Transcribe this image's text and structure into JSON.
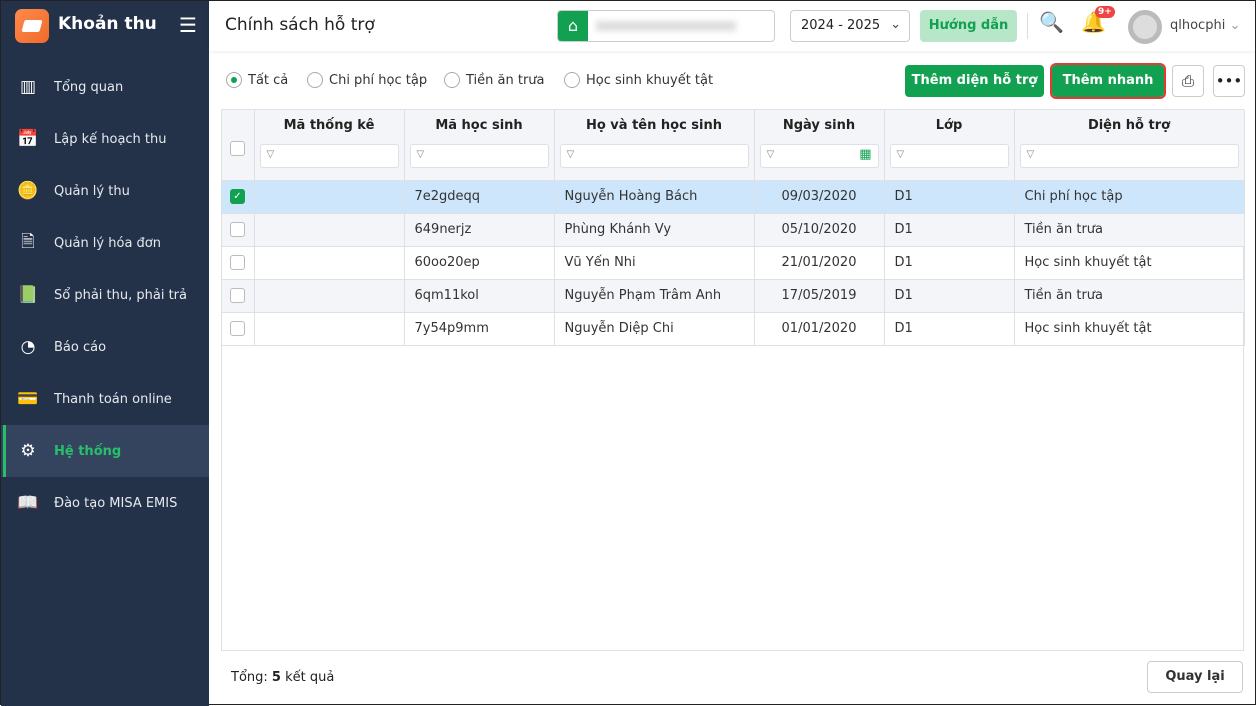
{
  "app": {
    "name": "Khoản thu"
  },
  "sidebar": {
    "items": [
      {
        "label": "Tổng quan",
        "icon": "bar-chart-icon"
      },
      {
        "label": "Lập kế hoạch thu",
        "icon": "calendar-dollar-icon"
      },
      {
        "label": "Quản lý thu",
        "icon": "hand-coin-icon"
      },
      {
        "label": "Quản lý hóa đơn",
        "icon": "document-icon"
      },
      {
        "label": "Sổ phải thu, phải trả",
        "icon": "ledger-icon"
      },
      {
        "label": "Báo cáo",
        "icon": "pie-chart-icon"
      },
      {
        "label": "Thanh toán online",
        "icon": "card-check-icon"
      },
      {
        "label": "Hệ thống",
        "icon": "gear-icon",
        "active": true
      },
      {
        "label": "Đào tạo MISA EMIS",
        "icon": "book-icon"
      }
    ]
  },
  "header": {
    "title": "Chính sách hỗ trợ",
    "year": "2024 - 2025",
    "guide": "Hướng dẫn",
    "badge": "9+",
    "user": "qlhocphi"
  },
  "filters": [
    "Tất cả",
    "Chi phí học tập",
    "Tiền ăn trưa",
    "Học sinh khuyết tật"
  ],
  "toolbar": {
    "add_type": "Thêm diện hỗ trợ",
    "quick_add": "Thêm nhanh"
  },
  "table": {
    "columns": [
      "Mã thống kê",
      "Mã học sinh",
      "Họ và tên học sinh",
      "Ngày sinh",
      "Lớp",
      "Diện hỗ trợ"
    ],
    "rows": [
      {
        "stat": "",
        "code": "7e2gdeqq",
        "name": "Nguyễn Hoàng Bách",
        "dob": "09/03/2020",
        "class": "D1",
        "type": "Chi phí học tập",
        "checked": true
      },
      {
        "stat": "",
        "code": "649nerjz",
        "name": "Phùng Khánh Vy",
        "dob": "05/10/2020",
        "class": "D1",
        "type": "Tiền ăn trưa"
      },
      {
        "stat": "",
        "code": "60oo20ep",
        "name": "Vũ Yến Nhi",
        "dob": "21/01/2020",
        "class": "D1",
        "type": "Học sinh khuyết tật"
      },
      {
        "stat": "",
        "code": "6qm11kol",
        "name": "Nguyễn Phạm Trâm Anh",
        "dob": "17/05/2019",
        "class": "D1",
        "type": "Tiền ăn trưa"
      },
      {
        "stat": "",
        "code": "7y54p9mm",
        "name": "Nguyễn Diệp Chi",
        "dob": "01/01/2020",
        "class": "D1",
        "type": "Học sinh khuyết tật"
      }
    ]
  },
  "footer": {
    "total_prefix": "Tổng: ",
    "total_count": "5",
    "total_suffix": " kết quả",
    "back": "Quay lại"
  }
}
